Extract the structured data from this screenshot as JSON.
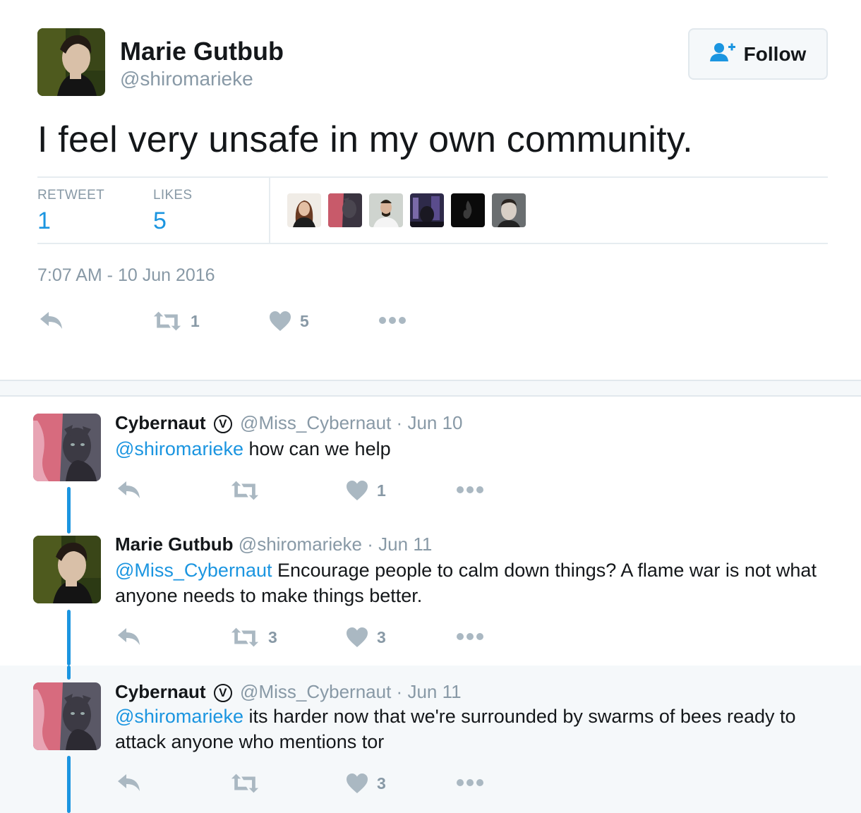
{
  "main_tweet": {
    "author_name": "Marie Gutbub",
    "author_handle": "@shiromarieke",
    "follow_label": "Follow",
    "text": "I feel very unsafe in my own community.",
    "stats": {
      "retweet_label": "RETWEET",
      "retweet_count": "1",
      "likes_label": "LIKES",
      "likes_count": "5"
    },
    "timestamp": "7:07 AM - 10 Jun 2016",
    "actions": {
      "retweet_count": "1",
      "like_count": "5"
    }
  },
  "replies": [
    {
      "name": "Cybernaut",
      "verified_mark": "V",
      "handle": "@Miss_Cybernaut",
      "separator": "·",
      "date": "Jun 10",
      "mention": "@shiromarieke",
      "text": " how can we help",
      "retweet_count": "",
      "like_count": "1"
    },
    {
      "name": "Marie Gutbub",
      "handle": "@shiromarieke",
      "separator": "·",
      "date": "Jun 11",
      "mention": "@Miss_Cybernaut",
      "text": " Encourage people to calm down things? A flame war is not what anyone needs to make things better.",
      "retweet_count": "3",
      "like_count": "3"
    },
    {
      "name": "Cybernaut",
      "verified_mark": "V",
      "handle": "@Miss_Cybernaut",
      "separator": "·",
      "date": "Jun 11",
      "mention": "@shiromarieke",
      "text": " its harder now that we're surrounded by swarms of bees ready to attack anyone who mentions tor",
      "retweet_count": "",
      "like_count": "3"
    }
  ],
  "icons": {
    "reply": "reply-icon",
    "retweet": "retweet-icon",
    "like": "heart-icon",
    "more": "more-icon",
    "follow": "add-user-icon"
  },
  "colors": {
    "accent": "#1b95e0",
    "muted": "#8899a6",
    "text": "#14171a",
    "highlight_bg": "#f5f8fa"
  }
}
